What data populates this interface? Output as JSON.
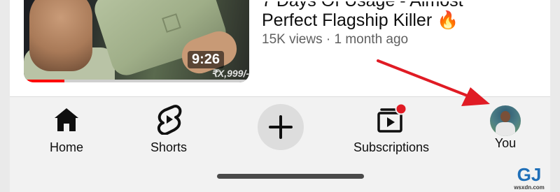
{
  "video": {
    "title_line1": "7 Days Of Usage - Almost",
    "title_line2": "Perfect Flagship Killer",
    "title_emoji": "🔥",
    "meta": "15K views · 1 month ago",
    "duration": "9:26",
    "thumb_text": "₹X,999/-",
    "watched_fraction": 0.18
  },
  "nav": {
    "home": "Home",
    "shorts": "Shorts",
    "create_icon": "plus-icon",
    "subscriptions": "Subscriptions",
    "you": "You"
  },
  "colors": {
    "arrow": "#e01b24",
    "notification_dot": "#e01b24",
    "progress": "#ff0000"
  },
  "watermark": {
    "logo": "GJ",
    "site": "wsxdn.com"
  }
}
